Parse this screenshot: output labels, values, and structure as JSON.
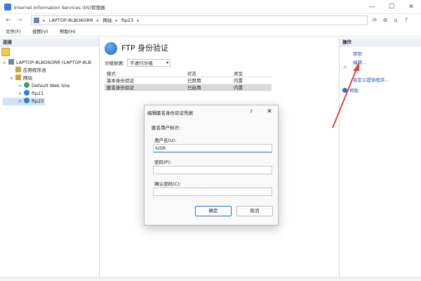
{
  "window": {
    "title": "Internet Information Services (IIS)管理器",
    "minimize": "—",
    "maximize": "☐",
    "close": "✕"
  },
  "address": {
    "back": "←",
    "forward": "→",
    "crumbs": [
      "LAPTOP-8LBO6ORR",
      "网站",
      "ftp23"
    ],
    "separator": "▸"
  },
  "menu": {
    "items": [
      "文件(F)",
      "视图(V)",
      "帮助(H)"
    ]
  },
  "connections": {
    "header": "连接",
    "tree": [
      {
        "label": "LAPTOP-8LBO6ORR (LAPTOP-8LB",
        "twisty": "∨",
        "icon_color": "#6c8aa8"
      },
      {
        "label": "应用程序池",
        "twisty": "",
        "icon_color": "#c8a23c"
      },
      {
        "label": "网站",
        "twisty": "∨",
        "icon_color": "#c8a23c"
      },
      {
        "label": "Default Web Site",
        "twisty": ">",
        "icon_color": "#3aa35b"
      },
      {
        "label": "ftp21",
        "twisty": ">",
        "icon_color": "#2d7fd3"
      },
      {
        "label": "ftp23",
        "twisty": ">",
        "icon_color": "#2d7fd3"
      }
    ]
  },
  "feature": {
    "title": "FTP 身份验证",
    "group_label": "分组依据:",
    "group_value": "不进行分组",
    "group_caret": "▾",
    "columns": [
      "模式",
      "状态",
      "类型"
    ],
    "rows": [
      [
        "基本身份验证",
        "已禁用",
        "内置"
      ],
      [
        "匿名身份验证",
        "已启用",
        "内置"
      ]
    ]
  },
  "dialog": {
    "title": "编辑匿名身份验证凭据",
    "help": "?",
    "close": "✕",
    "section": "匿名用户标识:",
    "username_label": "用户名(U):",
    "username_value": "IUSR",
    "password_label": "密码(P):",
    "password_value": "",
    "confirm_label": "确认密码(C):",
    "confirm_value": "",
    "ok": "确定",
    "cancel": "取消"
  },
  "actions": {
    "header": "操作",
    "disable": "禁用",
    "edit": "编辑...",
    "custom_provider": "自定义提供程序...",
    "help": "帮助"
  },
  "colors": {
    "accent": "#2a6fc9",
    "arrow": "#e0463b"
  }
}
